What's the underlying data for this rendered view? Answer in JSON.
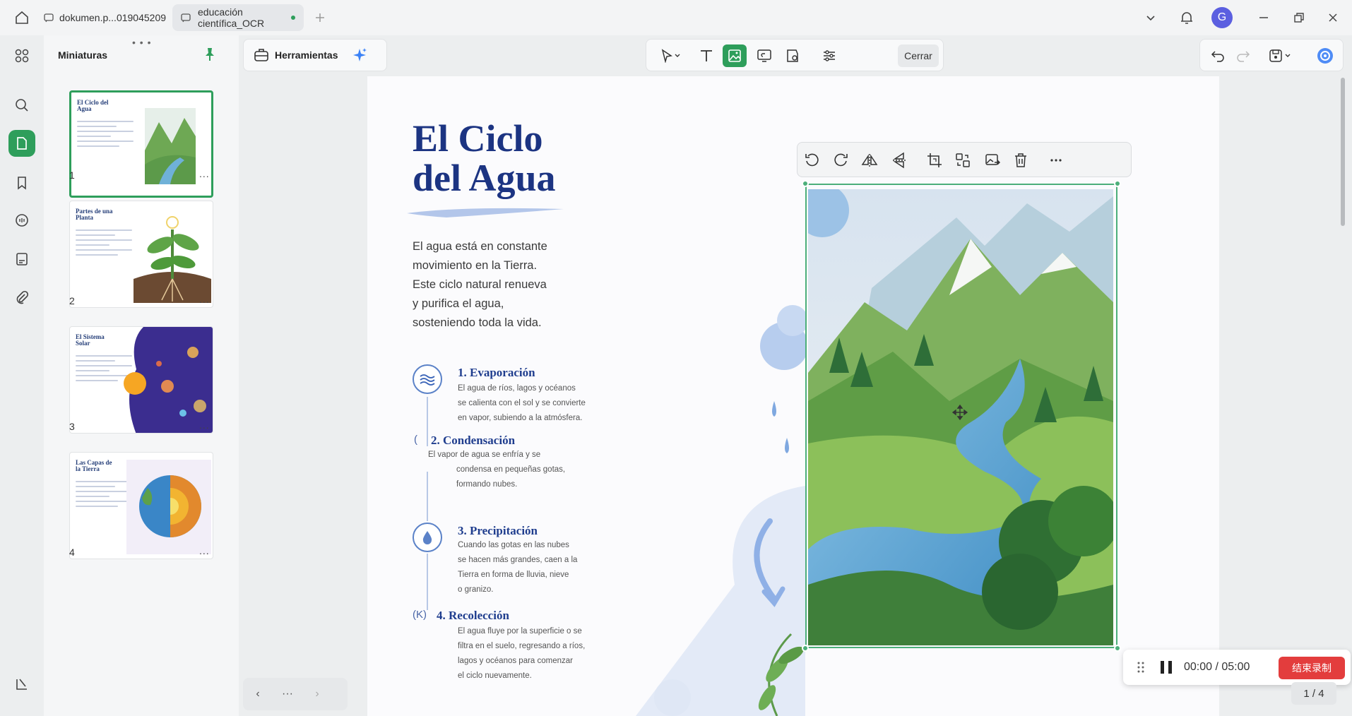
{
  "tabs": [
    {
      "title": "dokumen.p...019045209",
      "active": false
    },
    {
      "title_line1": "educación",
      "title_line2": "científica_OCR",
      "active": true
    }
  ],
  "user": {
    "avatar_initial": "G"
  },
  "thumbnails_panel": {
    "title": "Miniaturas",
    "drag_handle": "• • •",
    "pages": [
      {
        "number": "1",
        "title": "El Ciclo del Agua",
        "selected": true
      },
      {
        "number": "2",
        "title": "Partes de una Planta",
        "selected": false
      },
      {
        "number": "3",
        "title": "El Sistema Solar",
        "selected": false
      },
      {
        "number": "4",
        "title": "Las Capas de la Tierra",
        "selected": false
      }
    ],
    "more": "..."
  },
  "tools": {
    "label": "Herramientas"
  },
  "edit_toolbar": {
    "close_label": "Cerrar"
  },
  "page": {
    "title": "El Ciclo del Agua",
    "intro": [
      "El agua está en constante",
      "movimiento en la Tierra.",
      "Este ciclo natural renueva",
      "y purifica el agua,",
      "sosteniendo toda la vida."
    ],
    "steps": [
      {
        "title": "1. Evaporación",
        "desc": [
          "El agua de ríos, lagos y océanos",
          "se calienta con el sol y se convierte",
          "en vapor, subiendo a la atmósfera."
        ]
      },
      {
        "title": "2. Condensación",
        "prefix": "(",
        "desc": [
          "El vapor de agua se enfría y se",
          "condensa en pequeñas gotas,",
          "formando nubes."
        ]
      },
      {
        "title": "3. Precipitación",
        "desc": [
          "Cuando las gotas en las nubes",
          "se hacen más grandes, caen a la",
          "Tierra en forma de lluvia, nieve",
          "o granizo."
        ]
      },
      {
        "title": "4. Recolección",
        "prefix": "(K)",
        "desc": [
          "El agua fluye por la superficie o se",
          "filtra en el suelo, regresando a ríos,",
          "lagos y océanos para comenzar",
          "el ciclo nuevamente."
        ]
      }
    ]
  },
  "nav": {
    "prev": "‹",
    "more": "···",
    "next": "›"
  },
  "page_indicator": "1 / 4",
  "recorder": {
    "time": "00:00 / 05:00",
    "stop_label": "结束录制"
  },
  "colors": {
    "accent": "#2e9e5b",
    "title_blue": "#1c3482",
    "record_red": "#e33d3d"
  }
}
